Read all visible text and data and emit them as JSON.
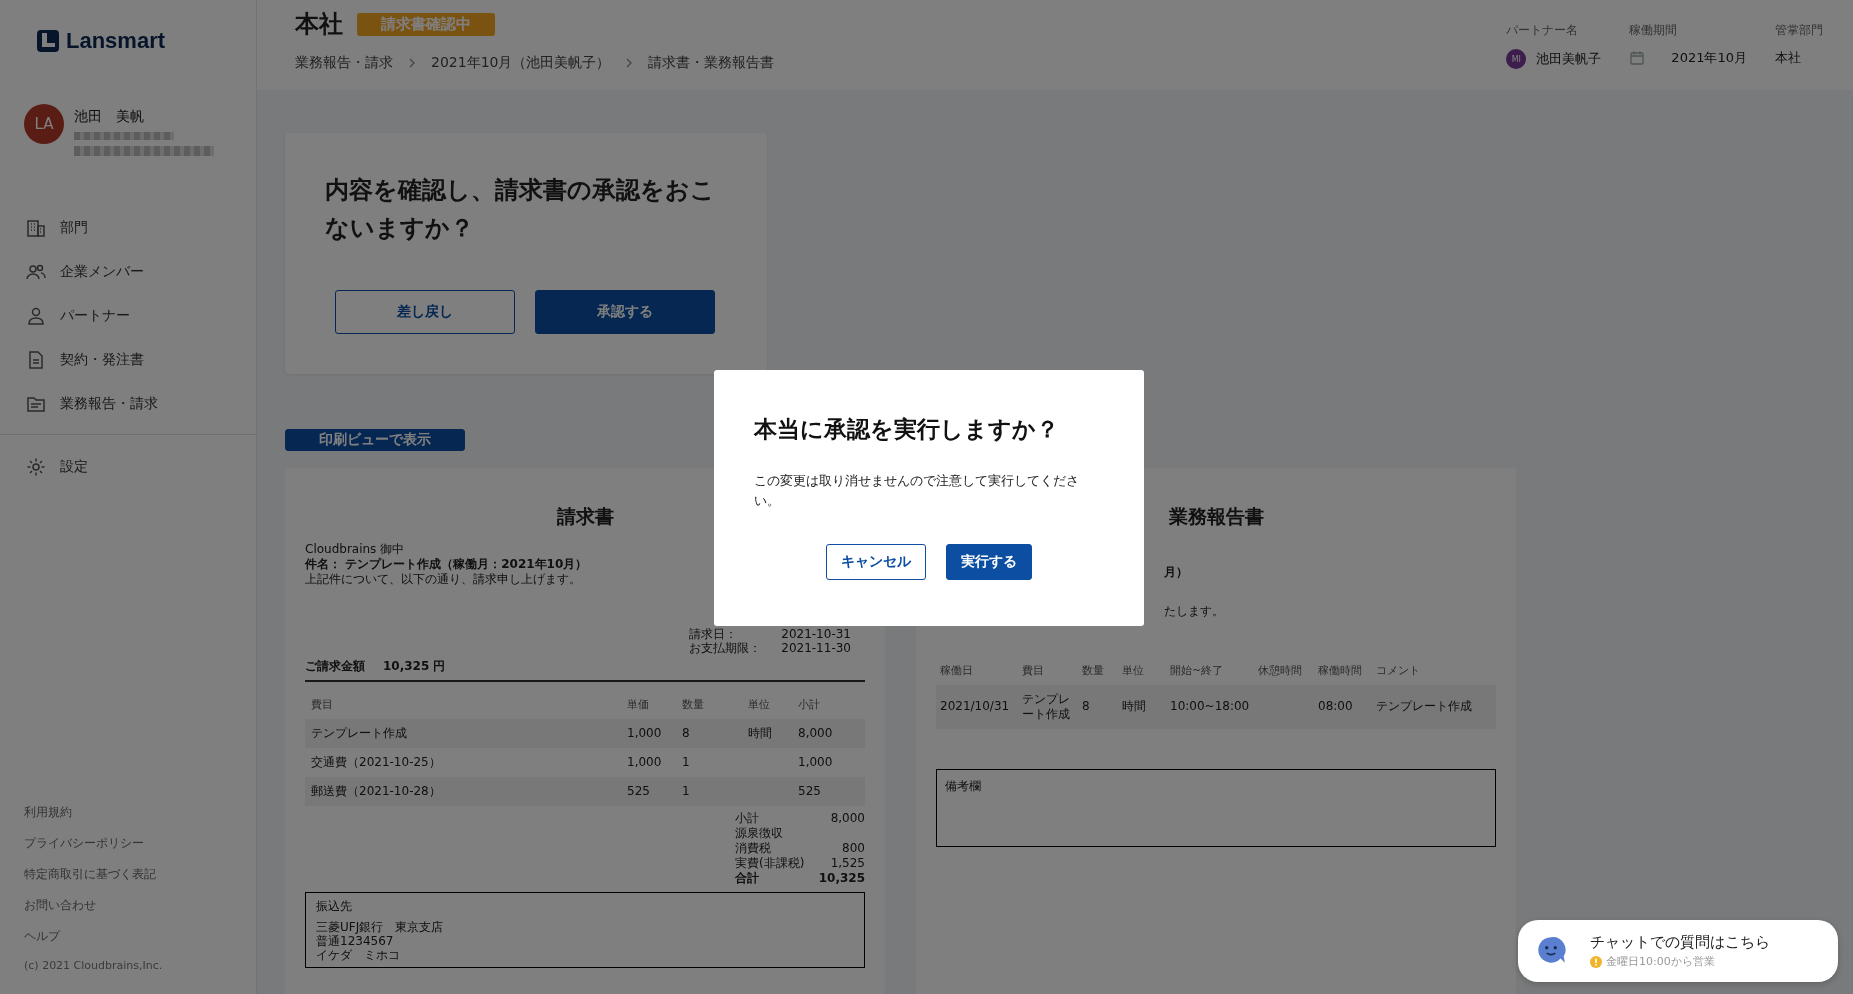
{
  "brand": {
    "name": "Lansmart"
  },
  "user": {
    "name": "池田　美帆",
    "initials": "LA"
  },
  "nav": [
    {
      "label": "部門",
      "kind": "building"
    },
    {
      "label": "企業メンバー",
      "kind": "people"
    },
    {
      "label": "パートナー",
      "kind": "person"
    },
    {
      "label": "契約・発注書",
      "kind": "document"
    },
    {
      "label": "業務報告・請求",
      "kind": "folder"
    }
  ],
  "settings": {
    "label": "設定",
    "kind": "gear"
  },
  "footer_links": [
    "利用規約",
    "プライバシーポリシー",
    "特定商取引に基づく表記",
    "お問い合わせ",
    "ヘルプ"
  ],
  "copyright": "(c) 2021 Cloudbrains,Inc.",
  "header": {
    "title": "本社",
    "status_badge": "請求書確認中",
    "breadcrumbs": [
      "業務報告・請求",
      "2021年10月（池田美帆子）",
      "請求書・業務報告書"
    ],
    "meta": [
      {
        "label": "パートナー名",
        "value": "池田美帆子",
        "kind": "avatar",
        "initials": "MI"
      },
      {
        "label": "稼働期間",
        "value": "2021年10月",
        "kind": "calendar"
      },
      {
        "label": "管掌部門",
        "value": "本社",
        "kind": "text"
      }
    ]
  },
  "approval": {
    "question": "内容を確認し、請求書の承認をおこないますか？",
    "buttons": [
      {
        "label": "差し戻し",
        "kind": "secondary"
      },
      {
        "label": "承認する",
        "kind": "primary"
      }
    ]
  },
  "print_button": "印刷ビューで表示",
  "invoice": {
    "title": "請求書",
    "addressee": "Cloudbrains 御中",
    "subject": "件名： テンプレート作成（稼働月：2021年10月）",
    "intro": "上記件について、以下の通り、請求申し上げます。",
    "meta": [
      {
        "label": "請求日：",
        "value": "2021-10-31"
      },
      {
        "label": "お支払期限：",
        "value": "2021-11-30"
      }
    ],
    "total_label": "ご請求金額",
    "total_value": "10,325 円",
    "columns": [
      "費目",
      "単価",
      "数量",
      "単位",
      "小計"
    ],
    "rows": [
      [
        "テンプレート作成",
        "1,000",
        "8",
        "時間",
        "8,000"
      ],
      [
        "交通費（2021-10-25）",
        "1,000",
        "1",
        "",
        "1,000"
      ],
      [
        "郵送費（2021-10-28）",
        "525",
        "1",
        "",
        "525"
      ]
    ],
    "summary": [
      {
        "label": "小計",
        "value": "8,000",
        "emphasis": false
      },
      {
        "label": "源泉徴収",
        "emphasis": false
      },
      {
        "label": "消費税",
        "value": "800",
        "emphasis": false
      },
      {
        "label": "実費(非課税)",
        "value": "1,525",
        "emphasis": false
      },
      {
        "label": "合計",
        "value": "10,325",
        "emphasis": true
      }
    ],
    "bank": {
      "title": "振込先",
      "lines": [
        "三菱UFJ銀行　東京支店",
        "普通1234567",
        "イケダ　ミホコ"
      ]
    }
  },
  "report": {
    "title": "業務報告書",
    "subject_fragment": "月）",
    "intro_fragment": "たします。",
    "columns": [
      "稼働日",
      "費目",
      "数量",
      "単位",
      "開始~終了",
      "休憩時間",
      "稼働時間",
      "コメント"
    ],
    "rows": [
      [
        "2021/10/31",
        "テンプレート作成",
        "8",
        "時間",
        "10:00~18:00",
        "",
        "08:00",
        "テンプレート作成"
      ]
    ],
    "notes_label": "備考欄"
  },
  "modal": {
    "title": "本当に承認を実行しますか？",
    "message": "この変更は取り消せませんので注意して実行してください。",
    "buttons": [
      {
        "label": "キャンセル",
        "kind": "secondary"
      },
      {
        "label": "実行する",
        "kind": "primary"
      }
    ]
  },
  "chat": {
    "title": "チャットでの質問はこちら",
    "hours": "金曜日10:00から営業"
  }
}
